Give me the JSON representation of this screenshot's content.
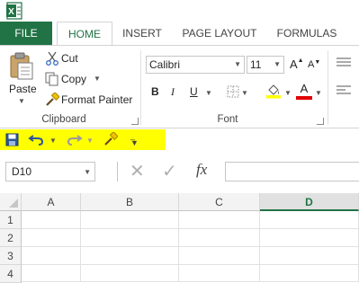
{
  "app": {
    "logo_text": "X"
  },
  "tabs": [
    {
      "label": "FILE"
    },
    {
      "label": "HOME"
    },
    {
      "label": "INSERT"
    },
    {
      "label": "PAGE LAYOUT"
    },
    {
      "label": "FORMULAS"
    }
  ],
  "ribbon": {
    "clipboard": {
      "paste_label": "Paste",
      "cut_label": "Cut",
      "copy_label": "Copy",
      "format_painter_label": "Format Painter",
      "group_label": "Clipboard"
    },
    "font": {
      "font_name": "Calibri",
      "font_size": "11",
      "bold": "B",
      "italic": "I",
      "underline": "U",
      "group_label": "Font"
    }
  },
  "formula_bar": {
    "name_box": "D10",
    "fx_label": "fx"
  },
  "grid": {
    "columns": [
      "A",
      "B",
      "C",
      "D"
    ],
    "rows": [
      "1",
      "2",
      "3",
      "4"
    ],
    "selected_column": "D"
  },
  "colors": {
    "brand": "#217346",
    "qat_highlight": "#ffff00",
    "font_color": "#e00000",
    "fill_color": "#ffff00"
  }
}
